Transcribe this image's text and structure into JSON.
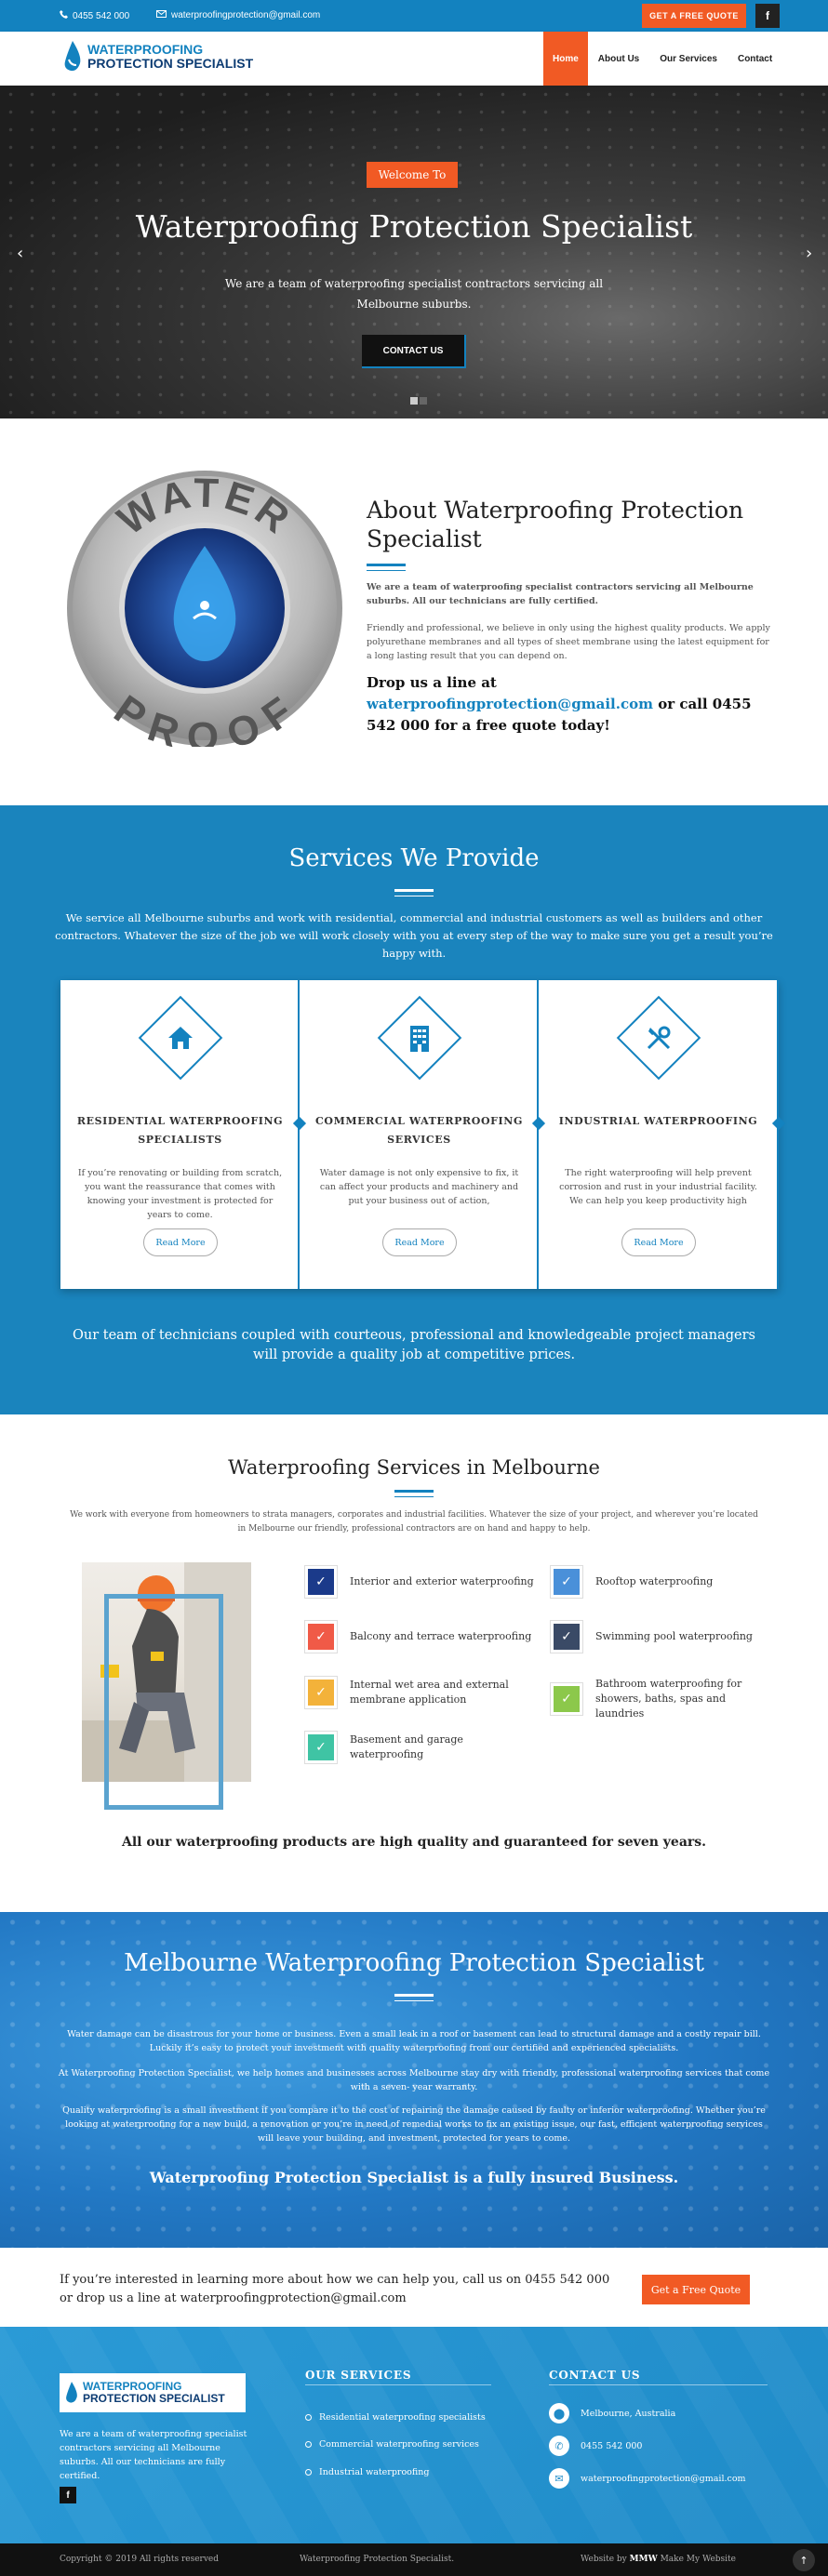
{
  "topbar": {
    "phone": "0455 542 000",
    "email": "waterproofingprotection@gmail.com",
    "quote_button": "GET A FREE QUOTE",
    "facebook": "f"
  },
  "logo": {
    "line1": "WATERPROOFING",
    "line2": "PROTECTION SPECIALIST"
  },
  "nav": [
    "Home",
    "About Us",
    "Our Services",
    "Contact"
  ],
  "hero": {
    "welcome": "Welcome To",
    "title": "Waterproofing Protection Specialist",
    "subtitle": "We are a team of waterproofing specialist contractors servicing all Melbourne suburbs.",
    "button": "CONTACT US",
    "prev": "‹",
    "next": "›"
  },
  "about": {
    "badge_top": "WATER",
    "badge_bottom": "PROOF",
    "title": "About Waterproofing Protection Specialist",
    "p1": "We are a team of waterproofing specialist contractors servicing all Melbourne suburbs. All our technicians are fully certified.",
    "p2": "Friendly and professional, we believe in only using the highest quality products. We apply polyurethane membranes and all types of sheet membrane using the latest equipment for a long lasting result that you can depend on.",
    "cta_pre": "Drop us a line at ",
    "cta_email": "waterproofingprotection@gmail.com",
    "cta_post": " or call 0455 542 000 for a free quote today!"
  },
  "services": {
    "title": "Services We Provide",
    "intro": "We service all Melbourne suburbs and work with residential, commercial and industrial customers as well as builders and other contractors. Whatever the size of the job we will work closely with you at every step of the way to make sure you get a result you’re happy with.",
    "cards": [
      {
        "icon": "house-icon",
        "title": "RESIDENTIAL WATERPROOFING SPECIALISTS",
        "text": "If you’re renovating or building from scratch, you want the reassurance that comes with knowing your investment is protected for years to come.",
        "button": "Read More"
      },
      {
        "icon": "building-icon",
        "title": "COMMERCIAL WATERPROOFING SERVICES",
        "text": "Water damage is not only expensive to fix, it can affect your products and machinery and put your business out of action,",
        "button": "Read More"
      },
      {
        "icon": "tools-icon",
        "title": "INDUSTRIAL WATERPROOFING",
        "text": "The right waterproofing will help prevent corrosion and rust in your industrial facility. We can help you keep productivity high",
        "button": "Read More"
      }
    ],
    "outro": "Our team of technicians coupled with courteous, professional and knowledgeable project managers will provide a quality job at competitive prices."
  },
  "melbourne": {
    "title": "Waterproofing Services in Melbourne",
    "intro": "We work with everyone from homeowners to strata managers, corporates and industrial facilities. Whatever the size of your project, and wherever you’re located in Melbourne our friendly, professional contractors are on hand and happy to help.",
    "features": [
      {
        "label": "Interior and exterior waterproofing",
        "color": "#1b3a8a",
        "icon": "check-icon"
      },
      {
        "label": "Rooftop waterproofing",
        "color": "#4a90d9",
        "icon": "check-icon"
      },
      {
        "label": "Balcony and terrace waterproofing",
        "color": "#f05a47",
        "icon": "check-icon"
      },
      {
        "label": "Swimming pool waterproofing",
        "color": "#3a4a66",
        "icon": "check-icon"
      },
      {
        "label": "Internal wet area and external membrane application",
        "color": "#f3b23a",
        "icon": "check-icon"
      },
      {
        "label": "Bathroom waterproofing for showers, baths, spas and laundries",
        "color": "#8cc84b",
        "icon": "check-icon"
      },
      {
        "label": "Basement and garage waterproofing",
        "color": "#3fc4a4",
        "icon": "check-icon"
      }
    ],
    "guarantee": "All our waterproofing products are high quality and guaranteed for seven years."
  },
  "water": {
    "title": "Melbourne Waterproofing Protection Specialist",
    "p1": "Water damage can be disastrous for your home or business. Even a small leak in a roof or basement can lead to structural damage and a costly repair bill. Luckily it’s easy to protect your investment with quality waterproofing from our certified and experienced specialists.",
    "p2": "At Waterproofing Protection Specialist, we help homes and businesses across Melbourne stay dry with friendly, professional waterproofing services that come with a seven- year warranty.",
    "p3": "Quality waterproofing is a small investment if you compare it to the cost of repairing the damage caused by faulty or inferior waterproofing. Whether you’re looking at waterproofing for a new build, a renovation or you’re in need of remedial works to fix an existing issue, our fast, efficient waterproofing services will leave your building, and investment, protected for years to come.",
    "insured": "Waterproofing Protection Specialist is a fully insured Business."
  },
  "interest": {
    "text": "If you’re interested in learning more about how we can help you, call us on 0455 542 000 or drop us a line at waterproofingprotection@gmail.com",
    "button": "Get a Free Quote"
  },
  "footer": {
    "about": "We are a team of waterproofing specialist contractors servicing all Melbourne suburbs. All our technicians are fully certified.",
    "facebook": "f",
    "services_title": "OUR SERVICES",
    "services": [
      "Residential waterproofing specialists",
      "Commercial waterproofing services",
      "Industrial waterproofing"
    ],
    "contact_title": "CONTACT US",
    "contact": [
      {
        "icon": "location-icon",
        "text": "Melbourne, Australia"
      },
      {
        "icon": "phone-icon",
        "text": "0455 542 000"
      },
      {
        "icon": "mail-icon",
        "text": "waterproofingprotection@gmail.com"
      }
    ]
  },
  "bottom": {
    "copyright": "Copyright © 2019 All rights reserved",
    "site": "Waterproofing Protection Specialist.",
    "credit": "Website by",
    "credit_brand": "Make My Website",
    "up": "↑"
  }
}
